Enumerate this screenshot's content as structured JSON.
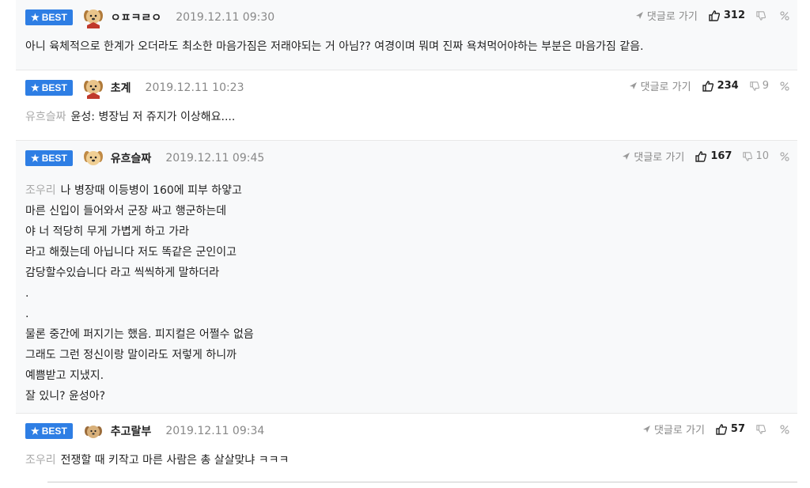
{
  "comments": [
    {
      "badge": "BEST",
      "nickname": "ㅇㅍㅋㄹㅇ",
      "date": "2019.12.11 09:30",
      "goto_label": "댓글로 가기",
      "likes": "312",
      "dislikes": "",
      "reply_to": "",
      "lines": [
        "아니 육체적으로 한계가 오더라도 최소한 마음가짐은 저래야되는 거 아님?? 여경이며 뭐며 진짜 욕쳐먹어야하는 부분은 마음가짐 같음."
      ]
    },
    {
      "badge": "BEST",
      "nickname": "초계",
      "date": "2019.12.11 10:23",
      "goto_label": "댓글로 가기",
      "likes": "234",
      "dislikes": "9",
      "reply_to": "유흐슬짜",
      "lines": [
        "윤성: 병장님 저 쥬지가 이상해요...."
      ]
    },
    {
      "badge": "BEST",
      "nickname": "유흐슬짜",
      "date": "2019.12.11 09:45",
      "goto_label": "댓글로 가기",
      "likes": "167",
      "dislikes": "10",
      "reply_to": "조우리",
      "lines": [
        "나 병장때 이등병이 160에 피부 하얗고",
        "마른 신입이 들어와서 군장 싸고 행군하는데",
        "야 너 적당히 무게 가볍게 하고 가라",
        "라고 해줬는데 아닙니다 저도 똑같은 군인이고",
        "감당할수있습니다 라고 씩씩하게 말하더라",
        ".",
        ".",
        "물론 중간에 퍼지기는 했음. 피지컬은 어쩔수 없음",
        "그래도 그런 정신이랑 말이라도 저렇게 하니까",
        "예쁨받고 지냈지.",
        "잘 있니? 윤성아?"
      ]
    },
    {
      "badge": "BEST",
      "nickname": "추고랄부",
      "date": "2019.12.11 09:34",
      "goto_label": "댓글로 가기",
      "likes": "57",
      "dislikes": "",
      "reply_to": "조우리",
      "lines": [
        "전쟁할 때 키작고 마른 사람은 총 살살맞냐 ㅋㅋㅋ"
      ]
    }
  ],
  "icons": {
    "badge": "star-icon",
    "avatar": "puppy-avatar-icon",
    "goto": "send-arrow-icon",
    "like": "thumbs-up-icon",
    "dislike": "thumbs-down-icon",
    "share": "percent-link-icon"
  },
  "colors": {
    "badge_bg": "#2e7ee4",
    "shaded_bg": "#f8f9fa",
    "reply_text": "#aaaaaa"
  }
}
